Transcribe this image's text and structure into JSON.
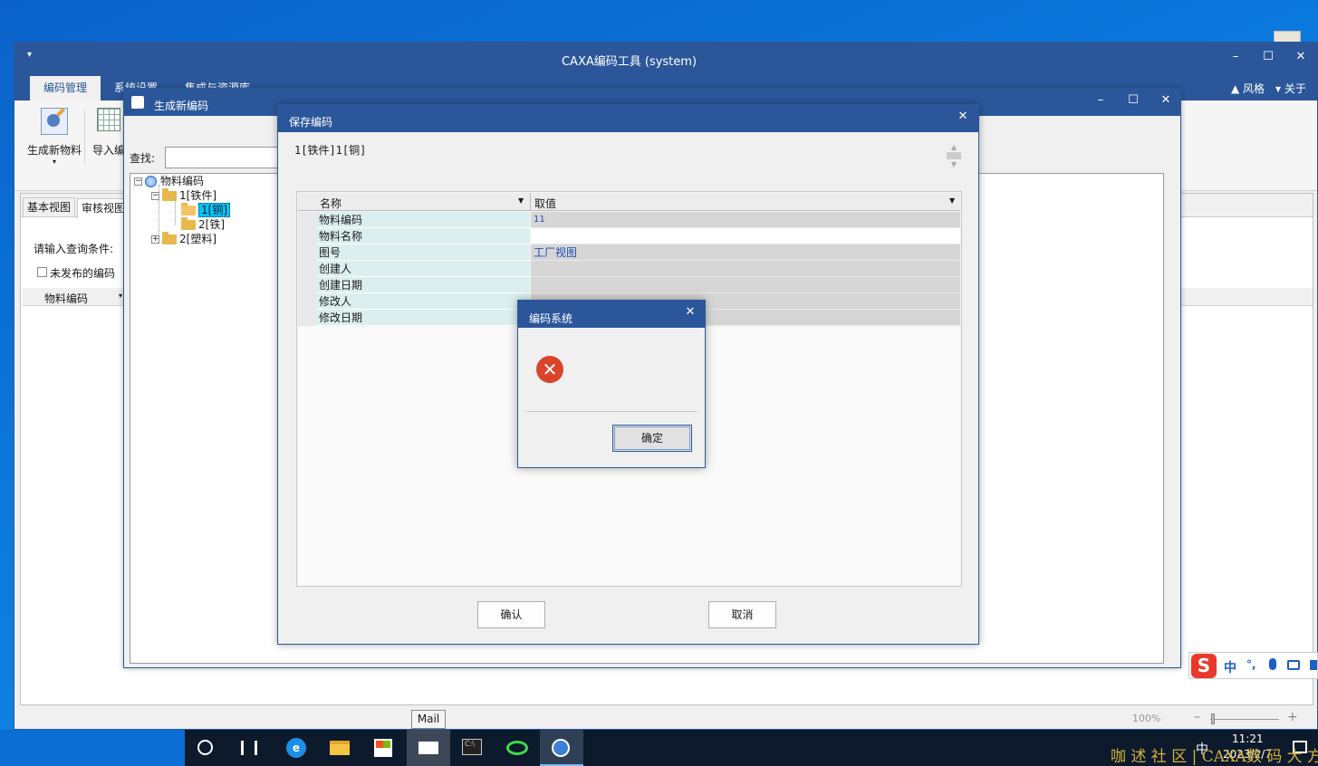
{
  "main_window": {
    "title": "CAXA编码工具 (system)",
    "quick_access": "▾",
    "ribbon_tabs": [
      "编码管理",
      "系统设置",
      "集成与资源库"
    ],
    "right_menu": {
      "style": "风格",
      "about": "关于"
    },
    "toolbar": {
      "new_material": "生成新物料",
      "import": "导入编"
    },
    "view_tabs": [
      "基本视图",
      "审核视图"
    ],
    "query_label": "请输入查询条件:",
    "unpublished_label": "未发布的编码",
    "column_header": "物料编码",
    "zoom": "100%"
  },
  "gen_window": {
    "title": "生成新编码",
    "search_label": "查找:",
    "tree": [
      {
        "label": "物料编码",
        "level": 0,
        "expander": "⊟",
        "icon": "globe-icon"
      },
      {
        "label": "1[铁件]",
        "level": 1,
        "expander": "⊟",
        "icon": "folder-icon"
      },
      {
        "label": "1[铜]",
        "level": 2,
        "expander": "",
        "icon": "folder-open-icon",
        "selected": true
      },
      {
        "label": "2[铁]",
        "level": 2,
        "expander": "",
        "icon": "folder-icon"
      },
      {
        "label": "2[塑料]",
        "level": 1,
        "expander": "⊞",
        "icon": "folder-icon"
      }
    ]
  },
  "save_dialog": {
    "title": "保存编码",
    "code_text": "1[铁件]1[铜]",
    "grid_headers": {
      "name": "名称",
      "value": "取值"
    },
    "rows": [
      {
        "name": "物料编码",
        "value": "11"
      },
      {
        "name": "物料名称",
        "value": ""
      },
      {
        "name": "图号",
        "value": "工厂视图"
      },
      {
        "name": "创建人",
        "value": ""
      },
      {
        "name": "创建日期",
        "value": ""
      },
      {
        "name": "修改人",
        "value": ""
      },
      {
        "name": "修改日期",
        "value": ""
      }
    ],
    "confirm_label": "确认",
    "cancel_label": "取消"
  },
  "msgbox": {
    "title": "编码系统",
    "ok_label": "确定",
    "icon": "error-icon"
  },
  "taskbar": {
    "tooltip": "Mail",
    "time": "11:21",
    "date": "2023/2/7",
    "ime_label": "中",
    "watermark": "咖 述 社 区 | CAXA数 码 大 方"
  },
  "ime_bar": {
    "lang": "中",
    "punct": "°,"
  }
}
